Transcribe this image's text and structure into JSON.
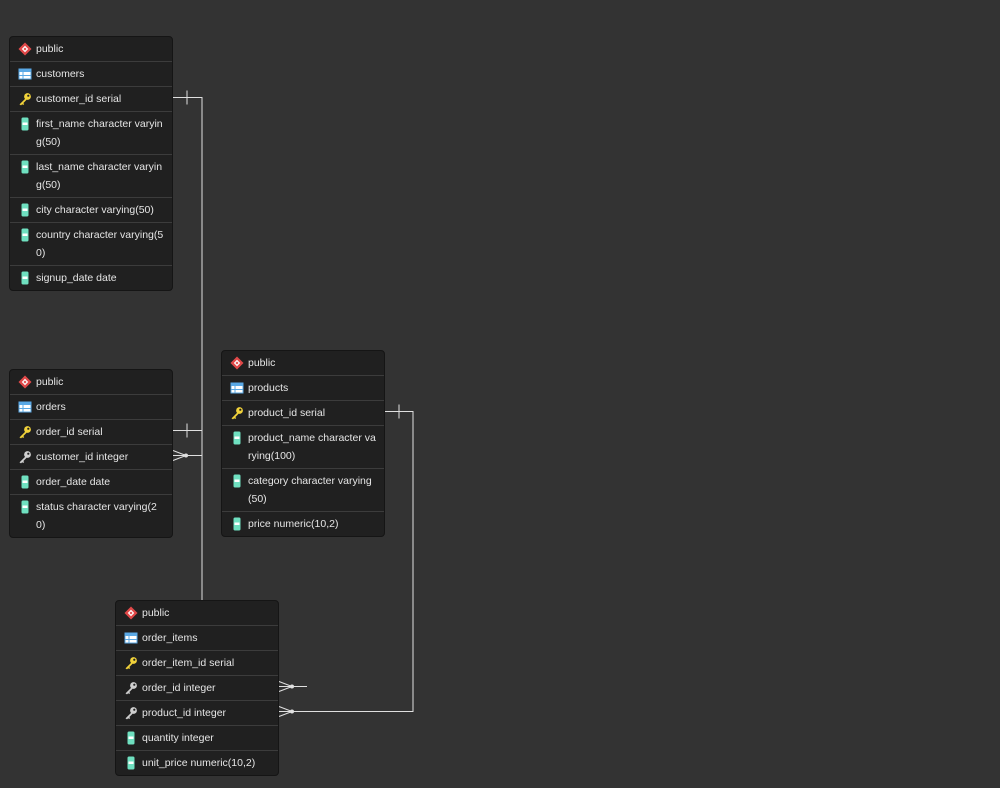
{
  "colors": {
    "background": "#333333",
    "node_bg": "#202020",
    "row_border": "#3c3c3c",
    "text": "#e6e6e6",
    "link": "#e0e0e0",
    "schema_icon": "#e04848",
    "table_icon": "#5aa9e6",
    "pk_icon": "#f2d33a",
    "fk_icon": "#cfcfcf",
    "column_icon": "#6fe0c0"
  },
  "tables": [
    {
      "id": "customers",
      "schema": "public",
      "name": "customers",
      "columns": [
        {
          "label": "customer_id serial",
          "kind": "pk"
        },
        {
          "label": "first_name character varying(50)",
          "kind": "col"
        },
        {
          "label": "last_name character varying(50)",
          "kind": "col"
        },
        {
          "label": "city character varying(50)",
          "kind": "col"
        },
        {
          "label": "country character varying(50)",
          "kind": "col"
        },
        {
          "label": "signup_date date",
          "kind": "col"
        }
      ]
    },
    {
      "id": "orders",
      "schema": "public",
      "name": "orders",
      "columns": [
        {
          "label": "order_id serial",
          "kind": "pk"
        },
        {
          "label": "customer_id integer",
          "kind": "fk"
        },
        {
          "label": "order_date date",
          "kind": "col"
        },
        {
          "label": "status character varying(20)",
          "kind": "col"
        }
      ]
    },
    {
      "id": "products",
      "schema": "public",
      "name": "products",
      "columns": [
        {
          "label": "product_id serial",
          "kind": "pk"
        },
        {
          "label": "product_name character varying(100)",
          "kind": "col"
        },
        {
          "label": "category character varying(50)",
          "kind": "col"
        },
        {
          "label": "price numeric(10,2)",
          "kind": "col"
        }
      ]
    },
    {
      "id": "order_items",
      "schema": "public",
      "name": "order_items",
      "columns": [
        {
          "label": "order_item_id serial",
          "kind": "pk"
        },
        {
          "label": "order_id integer",
          "kind": "fk"
        },
        {
          "label": "product_id integer",
          "kind": "fk"
        },
        {
          "label": "quantity integer",
          "kind": "col"
        },
        {
          "label": "unit_price numeric(10,2)",
          "kind": "col"
        }
      ]
    }
  ],
  "relationships": [
    {
      "from_table": "customers",
      "from_column": "customer_id serial",
      "to_table": "orders",
      "to_column": "customer_id integer"
    },
    {
      "from_table": "orders",
      "from_column": "order_id serial",
      "to_table": "order_items",
      "to_column": "order_id integer"
    },
    {
      "from_table": "products",
      "from_column": "product_id serial",
      "to_table": "order_items",
      "to_column": "product_id integer"
    }
  ]
}
